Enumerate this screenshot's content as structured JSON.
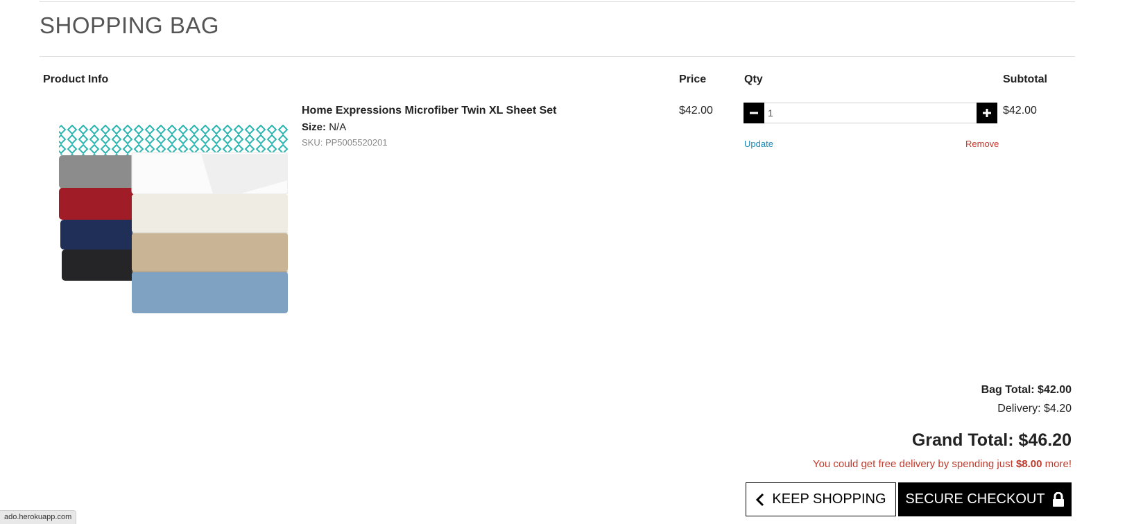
{
  "page": {
    "title": "SHOPPING BAG"
  },
  "table": {
    "headers": {
      "product_info": "Product Info",
      "price": "Price",
      "qty": "Qty",
      "subtotal": "Subtotal"
    }
  },
  "items": [
    {
      "name": "Home Expressions Microfiber Twin XL Sheet Set",
      "size_label": "Size:",
      "size_value": "N/A",
      "sku": "SKU: PP5005520201",
      "price": "$42.00",
      "qty": "1",
      "subtotal": "$42.00",
      "update_label": "Update",
      "remove_label": "Remove",
      "image_icon": "sheet-set-stack"
    }
  ],
  "totals": {
    "bag_total": "Bag Total: $42.00",
    "delivery": "Delivery: $4.20",
    "grand_total": "Grand Total: $46.20",
    "free_delivery_prefix": "You could get free delivery by spending just",
    "free_delivery_amount": "$8.00",
    "free_delivery_suffix": "more!"
  },
  "buttons": {
    "keep_shopping": "KEEP SHOPPING",
    "secure_checkout": "SECURE CHECKOUT",
    "keep_icon": "chevron-left-icon",
    "checkout_icon": "lock-icon"
  },
  "status_bar": {
    "url": "ado.herokuapp.com"
  },
  "colors": {
    "accent_link": "#1e88b4",
    "danger": "#c0392b",
    "button_dark": "#000000"
  }
}
